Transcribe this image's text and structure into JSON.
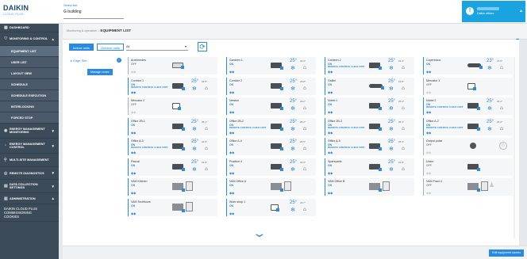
{
  "header": {
    "logo_text": "DAIKIN",
    "logo_sub": "CLOUD PLUS",
    "site_label": "Select site",
    "site_value": "G building",
    "user_role": "Daikin offices"
  },
  "sidebar": [
    {
      "label": "DASHBOARD",
      "icon": "dashboard-icon",
      "glyph": "▦",
      "type": "top",
      "h": 11
    },
    {
      "label": "MONITORING & CONTROL",
      "icon": "monitoring-icon",
      "glyph": "♡",
      "type": "top",
      "caret": "▲",
      "h": 17
    },
    {
      "label": "EQUIPMENT LIST",
      "type": "sub",
      "active": true,
      "h": 14
    },
    {
      "label": "USER LIST",
      "type": "sub",
      "h": 14
    },
    {
      "label": "LAYOUT VIEW",
      "type": "sub",
      "h": 14
    },
    {
      "label": "SCHEDULE",
      "type": "sub",
      "h": 14
    },
    {
      "label": "SCHEDULE EXECUTION",
      "type": "sub",
      "h": 14
    },
    {
      "label": "INTERLOCKING",
      "type": "sub",
      "h": 14
    },
    {
      "label": "FORCED STOP",
      "type": "sub",
      "h": 14
    },
    {
      "label": "ENERGY MANAGEMENT MONITORING",
      "icon": "energy-icon",
      "glyph": "◉",
      "type": "top",
      "caret": "▼",
      "h": 19
    },
    {
      "label": "ENERGY MANAGEMENT CONTROL",
      "icon": "energy-control-icon",
      "glyph": "◔",
      "type": "top",
      "caret": "▼",
      "h": 19
    },
    {
      "label": "MULTI-SITE MANAGEMENT",
      "icon": "multisite-icon",
      "glyph": "⚲",
      "type": "top",
      "h": 17
    },
    {
      "label": "REMOTE DIAGNOSTICS",
      "icon": "diagnostics-icon",
      "glyph": "◎",
      "type": "top",
      "caret": "▼",
      "h": 16
    },
    {
      "label": "DATA COLLECTION SETTINGS",
      "icon": "data-collection-icon",
      "glyph": "▤",
      "type": "top",
      "caret": "▼",
      "h": 17
    },
    {
      "label": "ADMINISTRATION",
      "icon": "admin-icon",
      "glyph": "▥",
      "type": "top",
      "caret": "▲",
      "h": 14
    },
    {
      "label": "DAIKIN CLOUD PLUS COMMISSIONING COOKIES",
      "type": "plain",
      "h": 22
    }
  ],
  "breadcrumb": {
    "parent": "Monitoring & operation",
    "separator": " > ",
    "current": "EQUIPMENT LIST"
  },
  "toolbar": {
    "indoor_label": "Indoor units",
    "outdoor_label": "Outdoor units",
    "filter_value": "All",
    "refresh_glyph": "⟳"
  },
  "zones": {
    "items": [
      {
        "label": "▸ Edge Site",
        "checked": true
      }
    ],
    "manage_label": "Manage zones"
  },
  "units": [
    {
      "name": "Archimedes",
      "status": "OFF",
      "off": true,
      "unit": "light"
    },
    {
      "name": "Canteen 1",
      "status": "ON",
      "temp": "25°",
      "room": "22.3°",
      "unit": "dark"
    },
    {
      "name": "Canteen 2",
      "status": "ON",
      "remote": "REMOTE CONTROL CHILD UNIT",
      "temp": "25°",
      "room": "22.4°",
      "unit": "dark"
    },
    {
      "name": "Copernicus",
      "status": "ON",
      "temp": "23°",
      "room": "27.5°",
      "unit": "wide"
    },
    {
      "name": "Corridor 1",
      "status": "ON",
      "remote": "REMOTE CONTROL CHILD UNIT",
      "temp": "25°",
      "room": "24.5°",
      "unit": "dark"
    },
    {
      "name": "Corridor 2",
      "status": "ON",
      "temp": "25°",
      "room": "25.8°",
      "unit": "dark"
    },
    {
      "name": "Galilei",
      "status": "ON",
      "temp": "25°",
      "room": "23.8°",
      "unit": "wide"
    },
    {
      "name": "Mercator 1",
      "status": "OFF",
      "off": true,
      "unit": "box"
    },
    {
      "name": "Mercator 2",
      "status": "OFF",
      "off": true,
      "unit": "box"
    },
    {
      "name": "Newton",
      "status": "ON",
      "temp": "25°",
      "room": "24.2°",
      "unit": "dark"
    },
    {
      "name": "Nobel 1",
      "status": "ON",
      "temp": "25°",
      "room": "25.3°",
      "unit": "dark"
    },
    {
      "name": "Nobel 2",
      "status": "ON",
      "remote": "REMOTE CONTROL CHILD UNIT",
      "temp": "25°",
      "room": "25.4°",
      "unit": "dark"
    },
    {
      "name": "Office 2B-1",
      "status": "ON",
      "temp": "25°",
      "room": "25.1°",
      "unit": "dark"
    },
    {
      "name": "Office 2B-2",
      "status": "ON",
      "remote": "REMOTE CONTROL CHILD UNIT",
      "temp": "25°",
      "room": "25.2°",
      "unit": "dark"
    },
    {
      "name": "Office 2B-3",
      "status": "ON",
      "remote": "REMOTE CONTROL CHILD UNIT",
      "temp": "25°",
      "room": "25.3°",
      "unit": "dark"
    },
    {
      "name": "Office A-2",
      "status": "ON",
      "remote": "REMOTE CONTROL CHILD UNIT",
      "temp": "25°",
      "room": "25.0°",
      "unit": "dark"
    },
    {
      "name": "Office A-3",
      "status": "ON",
      "remote": "REMOTE CONTROL CHILD UNIT",
      "temp": "25°",
      "room": "24.9°",
      "unit": "dark"
    },
    {
      "name": "Office A-4",
      "status": "ON",
      "temp": "25°",
      "room": "25.5°",
      "unit": "dark"
    },
    {
      "name": "Office A-5",
      "status": "ON",
      "remote": "REMOTE CONTROL CHILD UNIT",
      "temp": "25°",
      "room": "25.3°",
      "unit": "dark"
    },
    {
      "name": "Output pulse",
      "status": "OFF",
      "off": true,
      "unit": "knob",
      "power": true
    },
    {
      "name": "Pascal",
      "status": "ON",
      "temp": "25°",
      "room": "23.9°",
      "unit": "dark"
    },
    {
      "name": "Practice 4",
      "status": "ON",
      "temp": "25°",
      "room": "24.9°",
      "unit": "dark"
    },
    {
      "name": "Spareparts",
      "status": "ON",
      "temp": "25°",
      "room": "24.8°",
      "unit": "dark"
    },
    {
      "name": "Union",
      "status": "OFF",
      "off": true,
      "unit": "dark"
    },
    {
      "name": "VAM Kitchen",
      "status": "ON",
      "unit": "vam"
    },
    {
      "name": "VAM Office A",
      "status": "ON",
      "unit": "vam"
    },
    {
      "name": "VAM Office B",
      "status": "ON",
      "unit": "vam"
    },
    {
      "name": "VAM Pract 4",
      "status": "OFF",
      "off": true,
      "unit": "vam",
      "person": true
    },
    {
      "name": "VAM Techfloors",
      "status": "ON",
      "unit": "vam"
    },
    {
      "name": "Work shop 1",
      "status": "ON",
      "temp": "25°",
      "room": "22.7°",
      "unit": "box"
    }
  ],
  "footer": {
    "edit_label": "Edit equipment names"
  },
  "colors": {
    "accent": "#2a8ae0",
    "sidebar": "#3c4b5a",
    "user_panel": "#19a3e0"
  }
}
